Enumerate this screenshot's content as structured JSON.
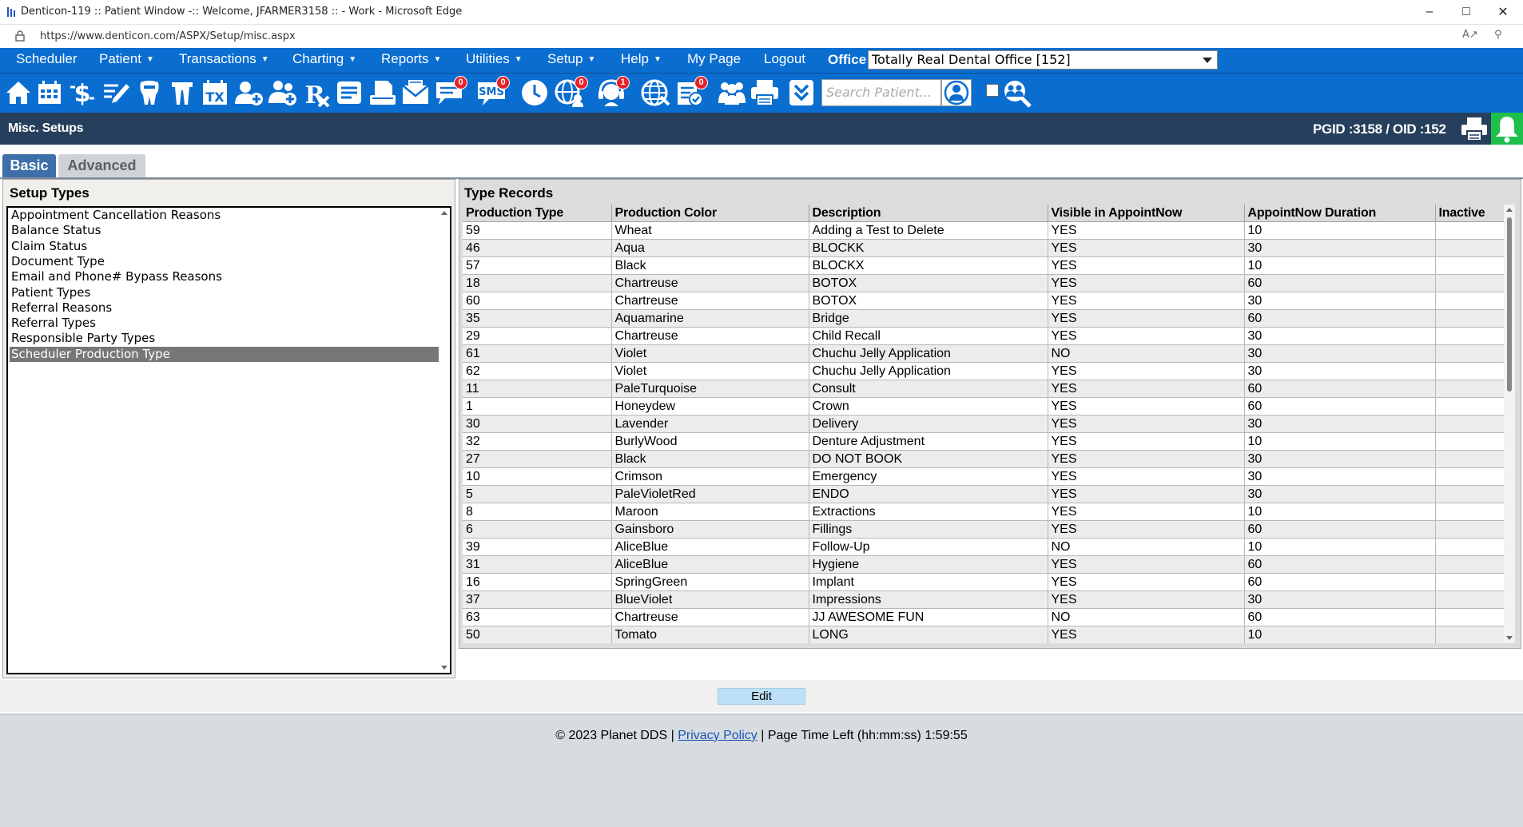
{
  "window": {
    "title": "Denticon-119 :: Patient Window -:: Welcome, JFARMER3158 :: - Work - Microsoft Edge",
    "url": "https://www.denticon.com/ASPX/Setup/misc.aspx"
  },
  "menu": {
    "items": [
      {
        "label": "Scheduler",
        "caret": false
      },
      {
        "label": "Patient",
        "caret": true
      },
      {
        "label": "Transactions",
        "caret": true
      },
      {
        "label": "Charting",
        "caret": true
      },
      {
        "label": "Reports",
        "caret": true
      },
      {
        "label": "Utilities",
        "caret": true
      },
      {
        "label": "Setup",
        "caret": true
      },
      {
        "label": "Help",
        "caret": true
      },
      {
        "label": "My Page",
        "caret": false
      },
      {
        "label": "Logout",
        "caret": false
      }
    ],
    "office_label": "Office",
    "office_value": "Totally Real Dental Office [152]"
  },
  "toolbar": {
    "search_placeholder": "Search Patient...",
    "badges": {
      "messages": "0",
      "sms": "0",
      "web": "0",
      "alerts": "1",
      "forms": "0"
    }
  },
  "page": {
    "title": "Misc. Setups",
    "ids": "PGID :3158  /  OID :152"
  },
  "tabs": {
    "basic": "Basic",
    "advanced": "Advanced"
  },
  "setup_types": {
    "heading": "Setup Types",
    "items": [
      "Appointment Cancellation Reasons",
      "Balance Status",
      "Claim Status",
      "Document Type",
      "Email and Phone# Bypass Reasons",
      "Patient Types",
      "Referral Reasons",
      "Referral Types",
      "Responsible Party Types",
      "Scheduler Production Type"
    ],
    "selected_index": 9
  },
  "records": {
    "heading": "Type Records",
    "columns": [
      "Production Type",
      "Production Color",
      "Description",
      "Visible in AppointNow",
      "AppointNow Duration",
      "Inactive"
    ],
    "rows": [
      [
        "59",
        "Wheat",
        "Adding a Test to Delete",
        "YES",
        "10",
        ""
      ],
      [
        "46",
        "Aqua",
        "BLOCKK",
        "YES",
        "30",
        ""
      ],
      [
        "57",
        "Black",
        "BLOCKX",
        "YES",
        "10",
        ""
      ],
      [
        "18",
        "Chartreuse",
        "BOTOX",
        "YES",
        "60",
        ""
      ],
      [
        "60",
        "Chartreuse",
        "BOTOX",
        "YES",
        "30",
        ""
      ],
      [
        "35",
        "Aquamarine",
        "Bridge",
        "YES",
        "60",
        ""
      ],
      [
        "29",
        "Chartreuse",
        "Child Recall",
        "YES",
        "30",
        ""
      ],
      [
        "61",
        "Violet",
        "Chuchu Jelly Application",
        "NO",
        "30",
        ""
      ],
      [
        "62",
        "Violet",
        "Chuchu Jelly Application",
        "YES",
        "30",
        ""
      ],
      [
        "11",
        "PaleTurquoise",
        "Consult",
        "YES",
        "60",
        ""
      ],
      [
        "1",
        "Honeydew",
        "Crown",
        "YES",
        "60",
        ""
      ],
      [
        "30",
        "Lavender",
        "Delivery",
        "YES",
        "30",
        ""
      ],
      [
        "32",
        "BurlyWood",
        "Denture Adjustment",
        "YES",
        "10",
        ""
      ],
      [
        "27",
        "Black",
        "DO NOT BOOK",
        "YES",
        "30",
        ""
      ],
      [
        "10",
        "Crimson",
        "Emergency",
        "YES",
        "30",
        ""
      ],
      [
        "5",
        "PaleVioletRed",
        "ENDO",
        "YES",
        "30",
        ""
      ],
      [
        "8",
        "Maroon",
        "Extractions",
        "YES",
        "10",
        ""
      ],
      [
        "6",
        "Gainsboro",
        "Fillings",
        "YES",
        "60",
        ""
      ],
      [
        "39",
        "AliceBlue",
        "Follow-Up",
        "NO",
        "10",
        ""
      ],
      [
        "31",
        "AliceBlue",
        "Hygiene",
        "YES",
        "60",
        ""
      ],
      [
        "16",
        "SpringGreen",
        "Implant",
        "YES",
        "60",
        ""
      ],
      [
        "37",
        "BlueViolet",
        "Impressions",
        "YES",
        "30",
        ""
      ],
      [
        "63",
        "Chartreuse",
        "JJ AWESOME FUN",
        "NO",
        "60",
        ""
      ],
      [
        "50",
        "Tomato",
        "LONG",
        "YES",
        "10",
        ""
      ]
    ]
  },
  "actions": {
    "edit_label": "Edit"
  },
  "footer": {
    "copyright": "© 2023 Planet DDS |",
    "privacy_link": "Privacy Policy",
    "time_left": "|  Page Time Left (hh:mm:ss) 1:59:55"
  }
}
